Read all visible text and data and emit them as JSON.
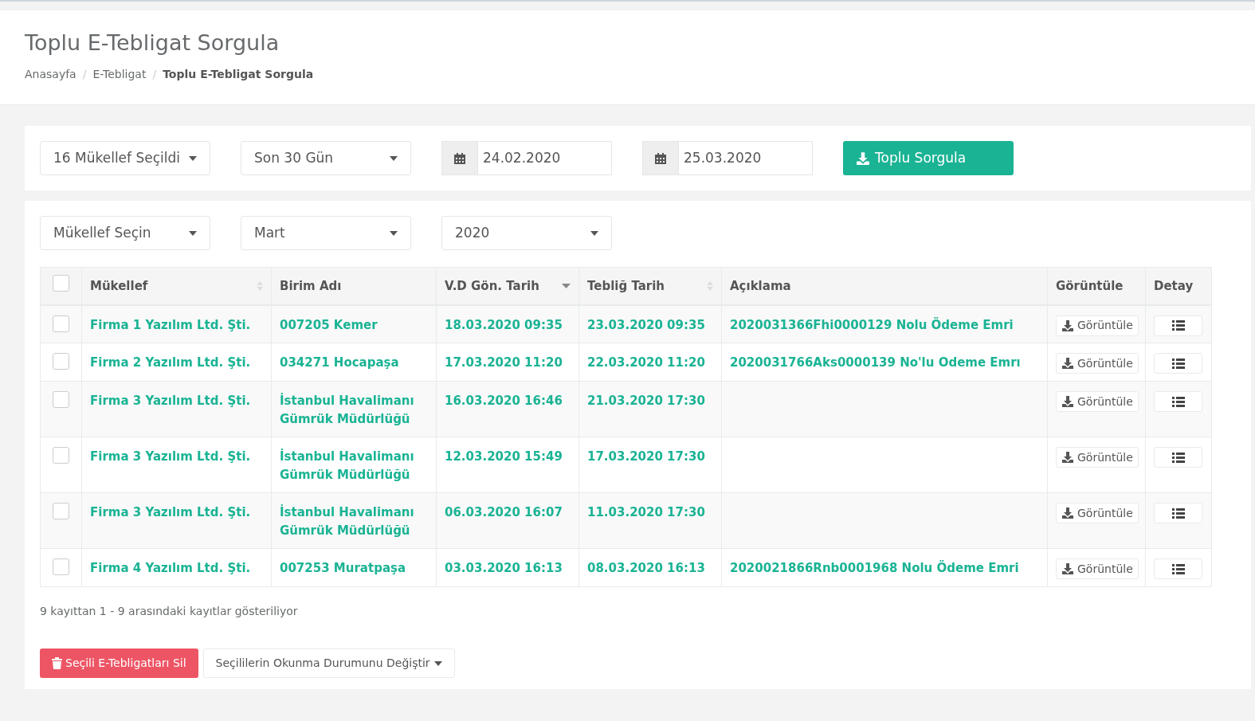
{
  "page": {
    "title": "Toplu E-Tebligat Sorgula",
    "breadcrumb": [
      "Anasayfa",
      "E-Tebligat",
      "Toplu E-Tebligat Sorgula"
    ],
    "breadcrumb_separator": "/"
  },
  "query": {
    "taxpayers": "16 Mükellef Seçildi",
    "period": "Son 30 Gün",
    "start_date": "24.02.2020",
    "end_date": "25.03.2020",
    "submit": "Toplu Sorgula"
  },
  "filters": [
    "Mükellef Seçin",
    "Mart",
    "2020"
  ],
  "table": {
    "select_all": false,
    "columns": [
      {
        "label": "Mükellef",
        "sortable": true,
        "sorted_descending": false
      },
      {
        "label": "Birim Adı",
        "sortable": false
      },
      {
        "label": "V.D Gön. Tarih",
        "sortable": true,
        "sorted_descending": true
      },
      {
        "label": "Tebliğ Tarih",
        "sortable": true,
        "sorted_descending": false
      },
      {
        "label": "Açıklama",
        "sortable": false
      },
      {
        "label": "Görüntüle",
        "sortable": false
      },
      {
        "label": "Detay",
        "sortable": false
      }
    ],
    "rows": [
      {
        "checked": false,
        "taxpayer": "Firma 1 Yazılım Ltd. Şti.",
        "unit": "007205 Kemer",
        "sent": "18.03.2020 09:35",
        "notified": "23.03.2020 09:35",
        "description": "2020031366Fhi0000129 Nolu Ödeme Emri",
        "view": "Görüntüle"
      },
      {
        "checked": false,
        "taxpayer": "Firma 2 Yazılım Ltd. Şti.",
        "unit": "034271 Hocapaşa",
        "sent": "17.03.2020 11:20",
        "notified": "22.03.2020 11:20",
        "description": "2020031766Aks0000139 No'lu Odeme Emrı",
        "view": "Görüntüle"
      },
      {
        "checked": false,
        "taxpayer": "Firma 3 Yazılım Ltd. Şti.",
        "unit": "İstanbul Havalimanı Gümrük Müdürlüğü",
        "sent": "16.03.2020 16:46",
        "notified": "21.03.2020 17:30",
        "view": "Görüntüle"
      },
      {
        "checked": false,
        "taxpayer": "Firma 3 Yazılım Ltd. Şti.",
        "unit": "İstanbul Havalimanı Gümrük Müdürlüğü",
        "sent": "12.03.2020 15:49",
        "notified": "17.03.2020 17:30",
        "view": "Görüntüle"
      },
      {
        "checked": false,
        "taxpayer": "Firma 3 Yazılım Ltd. Şti.",
        "unit": "İstanbul Havalimanı Gümrük Müdürlüğü",
        "sent": "06.03.2020 16:07",
        "notified": "11.03.2020 17:30",
        "view": "Görüntüle"
      },
      {
        "checked": false,
        "taxpayer": "Firma 4 Yazılım Ltd. Şti.",
        "unit": "007253 Muratpaşa",
        "sent": "03.03.2020 16:13",
        "notified": "08.03.2020 16:13",
        "description": "2020021866Rnb0001968 Nolu Ödeme Emri",
        "view": "Görüntüle"
      }
    ]
  },
  "info": "9 kayıttan 1 - 9 arasındaki kayıtlar gösteriliyor",
  "actions": {
    "delete": "Seçili E-Tebligatları Sil",
    "change_status": "Seçililerin Okunma Durumunu Değiştir"
  }
}
